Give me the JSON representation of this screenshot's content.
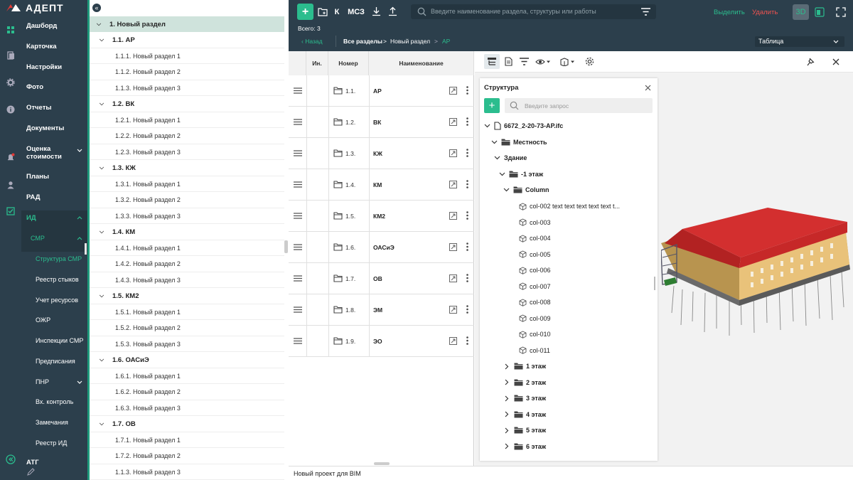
{
  "app": {
    "logo": "АДЕПТ",
    "brand_color": "#e53935",
    "accent": "#27a584"
  },
  "nav": [
    {
      "label": "Дашборд"
    },
    {
      "label": "Карточка"
    },
    {
      "label": "Настройки"
    },
    {
      "label": "Фото"
    },
    {
      "label": "Отчеты"
    },
    {
      "label": "Документы"
    },
    {
      "label": "Оценка стоимости"
    },
    {
      "label": "Планы"
    },
    {
      "label": "РАД"
    },
    {
      "label": "ИД"
    },
    {
      "label": "СМР"
    },
    {
      "label": "АТГ"
    }
  ],
  "smr_items": [
    "Структура СМР",
    "Реестр стыков",
    "Учет ресурсов",
    "ОЖР",
    "Инспекции СМР",
    "Предписания",
    "ПНР",
    "Вх. контроль",
    "Замечания",
    "Реестр ИД"
  ],
  "tree": {
    "root": "1. Новый раздел",
    "sections": [
      {
        "title": "1.1. АР",
        "items": [
          "1.1.1. Новый раздел 1",
          "1.1.2. Новый раздел 2",
          "1.1.3. Новый раздел 3"
        ]
      },
      {
        "title": "1.2. ВК",
        "items": [
          "1.2.1. Новый раздел 1",
          "1.2.2. Новый раздел 2",
          "1.2.3. Новый раздел 3"
        ]
      },
      {
        "title": "1.3. КЖ",
        "items": [
          "1.3.1. Новый раздел 1",
          "1.3.2. Новый раздел 2",
          "1.3.3. Новый раздел 3"
        ]
      },
      {
        "title": "1.4. КМ",
        "items": [
          "1.4.1. Новый раздел 1",
          "1.4.2. Новый раздел 2",
          "1.4.3. Новый раздел 3"
        ]
      },
      {
        "title": "1.5. КМ2",
        "items": [
          "1.5.1. Новый раздел 1",
          "1.5.2. Новый раздел 2",
          "1.5.3. Новый раздел 3"
        ]
      },
      {
        "title": "1.6. ОАСиЭ",
        "items": [
          "1.6.1. Новый раздел 1",
          "1.6.2. Новый раздел 2",
          "1.6.3. Новый раздел 3"
        ]
      },
      {
        "title": "1.7. ОВ",
        "items": [
          "1.7.1. Новый раздел 1",
          "1.7.2. Новый раздел 2",
          "1.1.3. Новый раздел 3"
        ]
      }
    ]
  },
  "toolbar": {
    "k_label": "К",
    "msz_label": "МСЗ",
    "search_placeholder": "Введите наименование раздела, структуры или работы",
    "select_label": "Выделить",
    "delete_label": "Удалить",
    "view_3d": "3D",
    "total": "Всего: 3",
    "back": "Назад",
    "crumbs": [
      "Все разделы",
      "Новый раздел",
      "АР"
    ],
    "view_select": "Таблица"
  },
  "table": {
    "headers": {
      "ind": "Ин.",
      "num": "Номер",
      "name": "Наименование"
    },
    "rows": [
      {
        "num": "1.1.",
        "name": "АР"
      },
      {
        "num": "1.2.",
        "name": "ВК"
      },
      {
        "num": "1.3.",
        "name": "КЖ"
      },
      {
        "num": "1.4.",
        "name": "КМ"
      },
      {
        "num": "1.5.",
        "name": "КМ2"
      },
      {
        "num": "1.6.",
        "name": "ОАСиЭ"
      },
      {
        "num": "1.7.",
        "name": "ОВ"
      },
      {
        "num": "1.8.",
        "name": "ЭМ"
      },
      {
        "num": "1.9.",
        "name": "ЭО"
      }
    ]
  },
  "structure": {
    "title": "Структура",
    "search_placeholder": "Введите запрос",
    "file": "6672_2-20-73-АР.ifc",
    "terrain": "Местность",
    "building": "Здание",
    "floor_minus1": "-1 этаж",
    "column": "Column",
    "cols": [
      "col-002 text text text text text t...",
      "col-003",
      "col-004",
      "col-005",
      "col-006",
      "col-007",
      "col-008",
      "col-009",
      "col-010",
      "col-011"
    ],
    "floors": [
      "1 этаж",
      "2 этаж",
      "3 этаж",
      "4 этаж",
      "5 этаж",
      "6 этаж"
    ]
  },
  "footer": "Новый проект для BIM"
}
